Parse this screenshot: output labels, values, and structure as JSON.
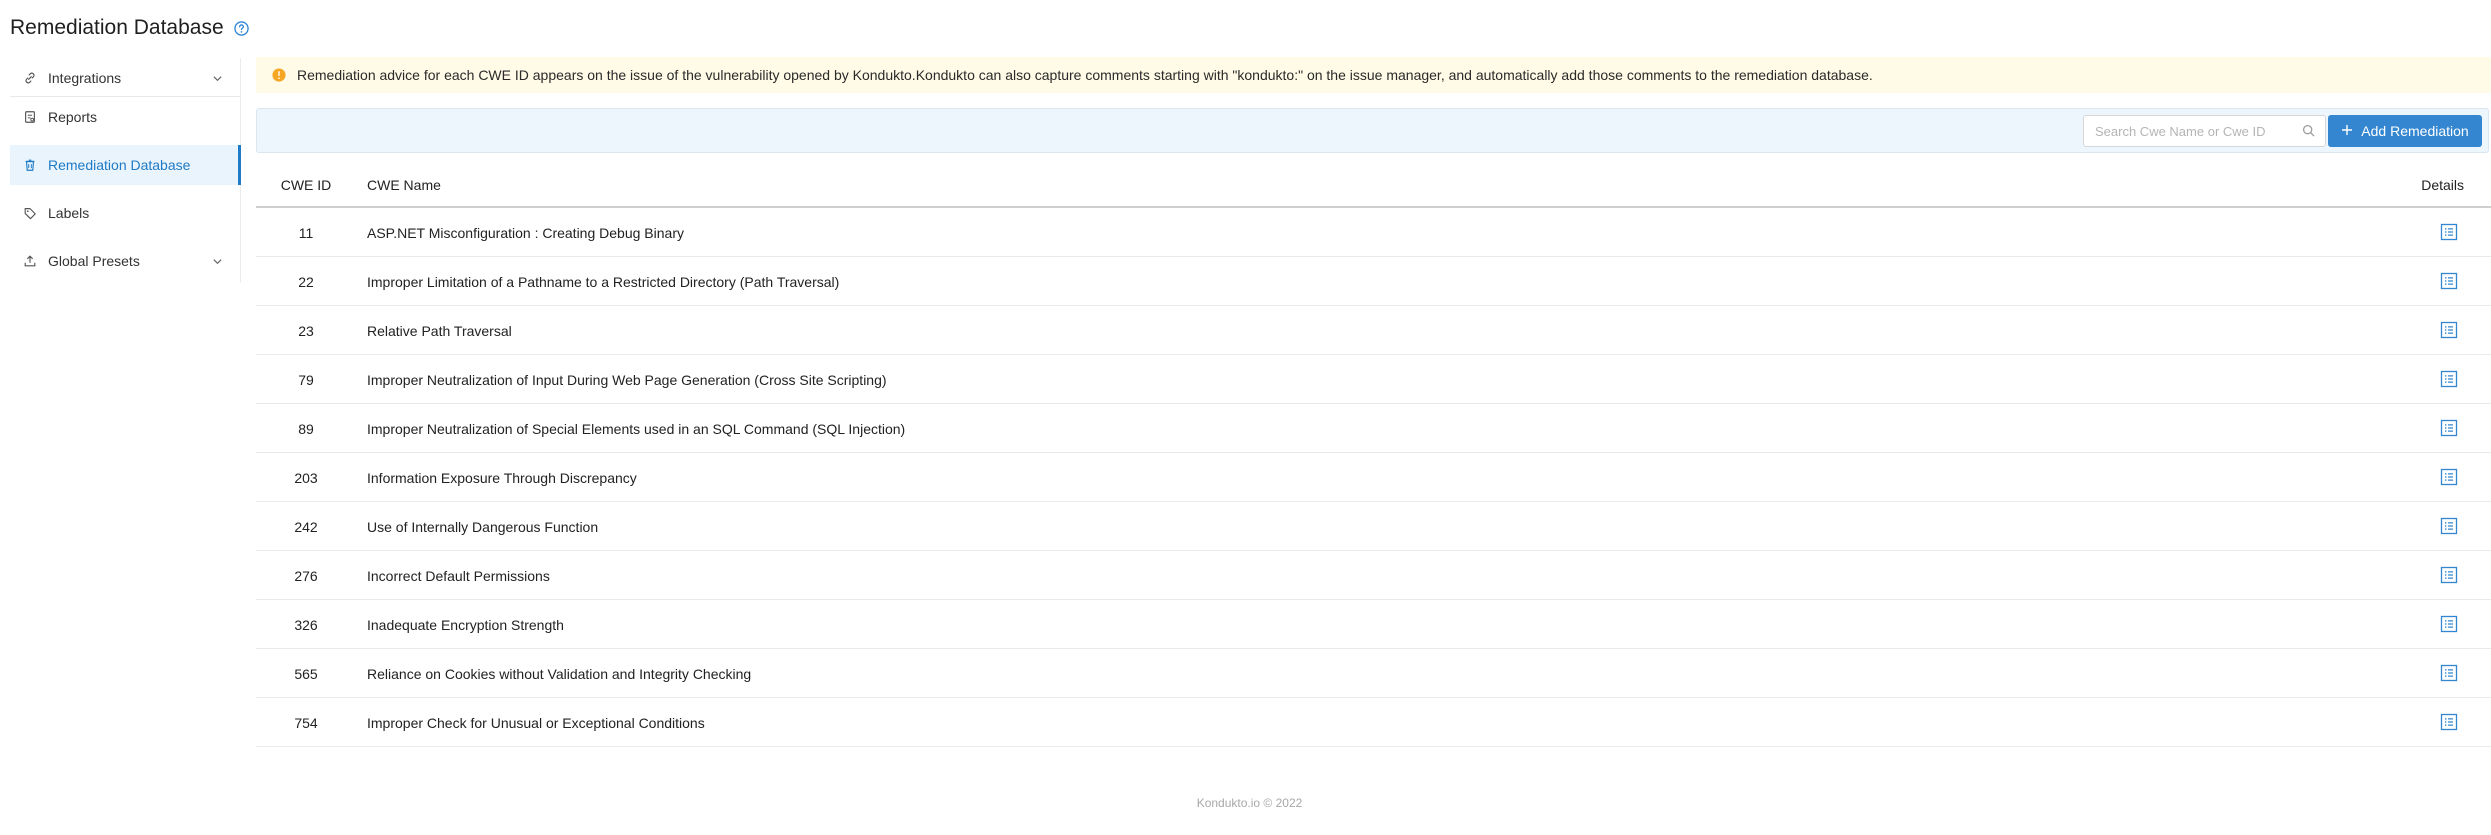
{
  "header": {
    "title": "Remediation Database",
    "help_icon": "question-circle-icon"
  },
  "sidebar": {
    "items": [
      {
        "label": "Integrations",
        "icon": "link-icon",
        "expandable": true
      },
      {
        "label": "Reports",
        "icon": "report-icon",
        "expandable": false
      },
      {
        "label": "Remediation Database",
        "icon": "trash-database-icon",
        "expandable": false,
        "active": true
      },
      {
        "label": "Labels",
        "icon": "tag-icon",
        "expandable": false
      },
      {
        "label": "Global Presets",
        "icon": "upload-icon",
        "expandable": true
      }
    ]
  },
  "alert": {
    "text": "Remediation advice for each CWE ID appears on the issue of the vulnerability opened by Kondukto.Kondukto can also capture comments starting with \"kondukto:\" on the issue manager, and automatically add those comments to the remediation database.",
    "icon": "exclamation-circle-icon",
    "color": "#f5a623"
  },
  "toolbar": {
    "search_placeholder": "Search Cwe Name or Cwe ID",
    "add_button_label": "Add Remediation",
    "accent_color": "#3386cf"
  },
  "table": {
    "columns": {
      "id": "CWE ID",
      "name": "CWE Name",
      "details": "Details"
    },
    "rows": [
      {
        "id": "11",
        "name": "ASP.NET Misconfiguration : Creating Debug Binary"
      },
      {
        "id": "22",
        "name": "Improper Limitation of a Pathname to a Restricted Directory (Path Traversal)"
      },
      {
        "id": "23",
        "name": "Relative Path Traversal"
      },
      {
        "id": "79",
        "name": "Improper Neutralization of Input During Web Page Generation (Cross Site Scripting)"
      },
      {
        "id": "89",
        "name": "Improper Neutralization of Special Elements used in an SQL Command (SQL Injection)"
      },
      {
        "id": "203",
        "name": "Information Exposure Through Discrepancy"
      },
      {
        "id": "242",
        "name": "Use of Internally Dangerous Function"
      },
      {
        "id": "276",
        "name": "Incorrect Default Permissions"
      },
      {
        "id": "326",
        "name": "Inadequate Encryption Strength"
      },
      {
        "id": "565",
        "name": "Reliance on Cookies without Validation and Integrity Checking"
      },
      {
        "id": "754",
        "name": "Improper Check for Unusual or Exceptional Conditions"
      }
    ]
  },
  "footer": {
    "text": "Kondukto.io © 2022"
  }
}
